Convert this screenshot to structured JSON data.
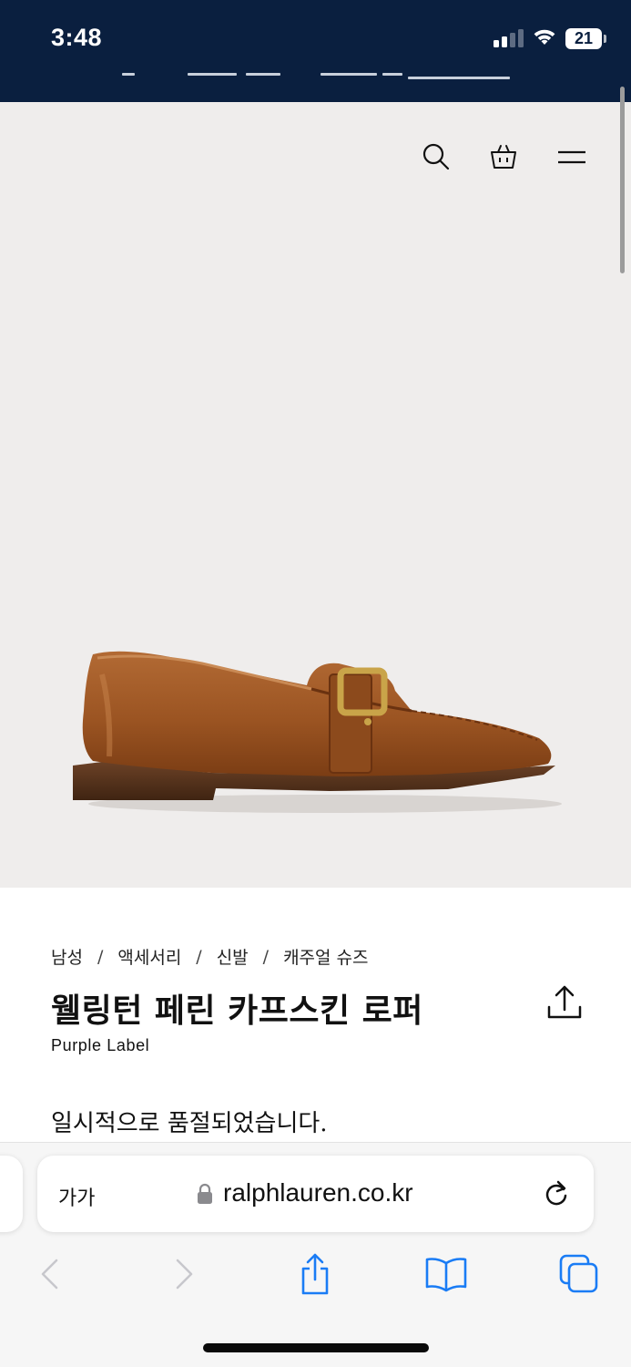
{
  "status_bar": {
    "time": "3:48",
    "battery": "21",
    "icons": [
      "signal-icon",
      "wifi-icon",
      "battery-icon"
    ]
  },
  "header": {
    "icons": [
      "search-icon",
      "shopping-bag-icon",
      "menu-icon"
    ]
  },
  "product": {
    "image": "loafer-shoe-image",
    "breadcrumb": [
      "남성",
      "액세서리",
      "신발",
      "캐주얼 슈즈"
    ],
    "breadcrumb_separator": "/",
    "title": "웰링턴 페린 카프스킨 로퍼",
    "brand": "Purple Label",
    "status": "일시적으로 품절되었습니다."
  },
  "browser": {
    "text_size_label": "가가",
    "url": "ralphlauren.co.kr",
    "toolbar": [
      "back-icon",
      "forward-icon",
      "share-icon",
      "bookmarks-icon",
      "tabs-icon"
    ]
  },
  "colors": {
    "status_bar_bg": "#0a1f3f",
    "hero_bg": "#efedec",
    "toolbar_accent": "#1a7cf5",
    "disabled": "#c7c7cc"
  }
}
